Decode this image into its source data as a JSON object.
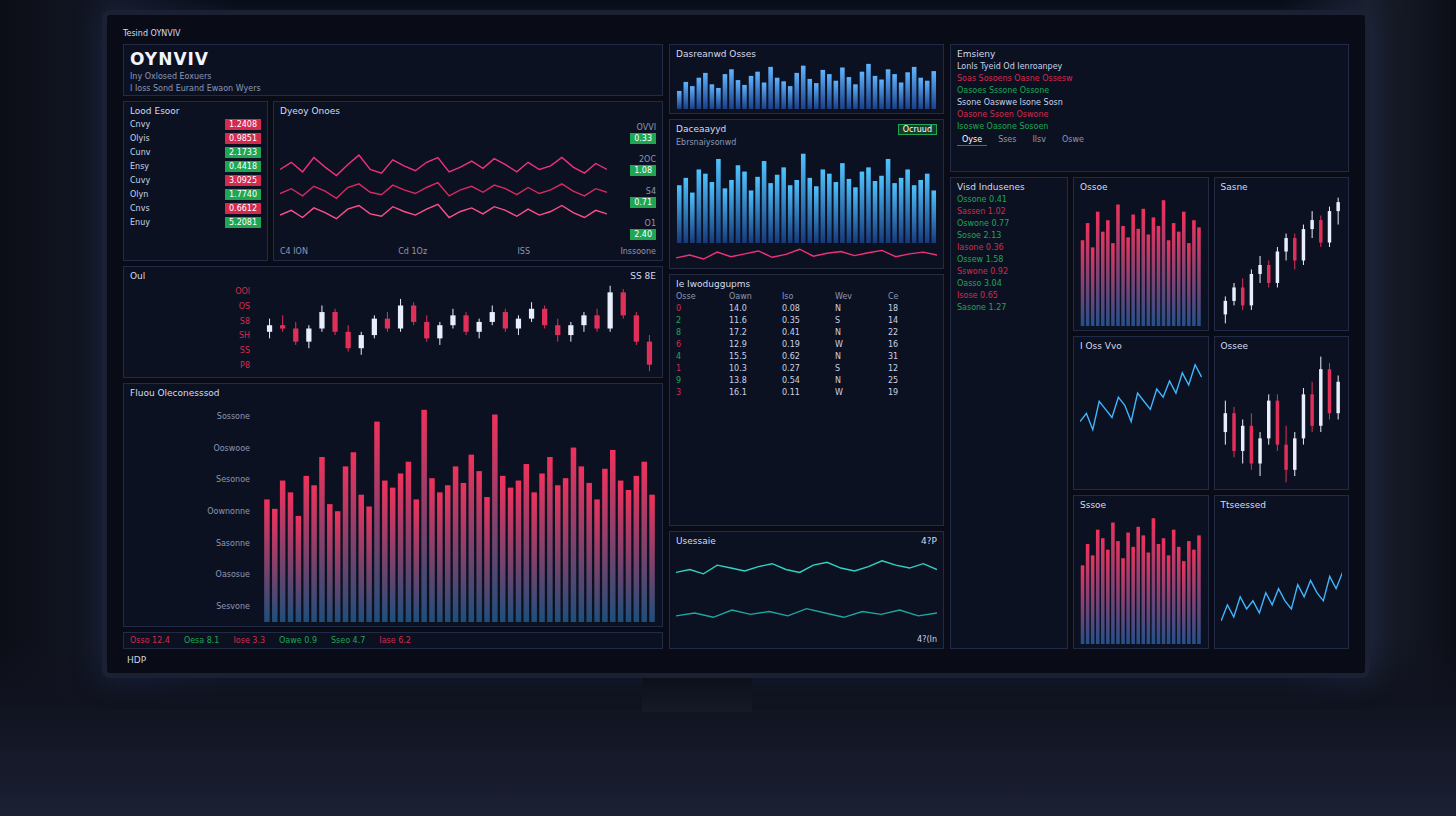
{
  "screen": {
    "title": "Tesind OYNVIV",
    "status": "HDP"
  },
  "header": {
    "logo": "OYNVIV",
    "subtitle": "Iny Oxlosed Eoxuers",
    "caption": "I Ioss Sond Eurand Ewaon Wyers"
  },
  "watchlist": {
    "title": "Lood Esoor",
    "rows": [
      {
        "name": "Cnvy",
        "value": "1.2408",
        "color": "#d42a4e"
      },
      {
        "name": "Olyis",
        "value": "0.9851",
        "color": "#d42a4e"
      },
      {
        "name": "Cunv",
        "value": "2.1733",
        "color": "#1fa653"
      },
      {
        "name": "Ensy",
        "value": "0.4418",
        "color": "#1fa653"
      },
      {
        "name": "Cuvy",
        "value": "3.0925",
        "color": "#d42a4e"
      },
      {
        "name": "Olyn",
        "value": "1.7740",
        "color": "#1fa653"
      },
      {
        "name": "Cnvs",
        "value": "0.6612",
        "color": "#d42a4e"
      },
      {
        "name": "Enuy",
        "value": "5.2081",
        "color": "#1fa653"
      }
    ]
  },
  "line_panel": {
    "title": "Dyeoy Onoes",
    "axis": [
      "C4 ION",
      "Cd 1Oz",
      "ISS",
      "Inssoone"
    ],
    "series": [
      [
        60,
        66,
        58,
        70,
        62,
        55,
        64,
        72,
        60,
        57,
        68,
        63,
        59,
        66,
        70,
        58,
        62,
        67,
        61,
        69,
        64,
        58,
        66,
        60,
        63,
        70,
        62,
        57,
        65,
        60
      ],
      [
        40,
        44,
        38,
        46,
        42,
        36,
        45,
        48,
        41,
        39,
        47,
        43,
        40,
        45,
        49,
        38,
        43,
        46,
        41,
        47,
        44,
        39,
        45,
        40,
        43,
        48,
        42,
        38,
        44,
        41
      ],
      [
        22,
        26,
        20,
        28,
        24,
        19,
        27,
        30,
        23,
        21,
        29,
        25,
        22,
        27,
        31,
        20,
        25,
        28,
        23,
        29,
        26,
        21,
        27,
        22,
        25,
        30,
        24,
        20,
        26,
        23
      ]
    ],
    "side": [
      {
        "label": "OVVI",
        "value": "0.33",
        "color": "#1fa653"
      },
      {
        "label": "2OC",
        "value": "1.08",
        "color": "#1fa653"
      },
      {
        "label": "S4",
        "value": "0.71",
        "color": "#1fa653"
      },
      {
        "label": "O1",
        "value": "2.40",
        "color": "#1fa653"
      }
    ]
  },
  "candles": {
    "title": "Oul",
    "reading": "SS 8E",
    "labels": [
      "OOl",
      "OS",
      "S8",
      "SH",
      "SS",
      "P8"
    ],
    "values": [
      [
        50,
        54,
        48,
        52
      ],
      [
        52,
        55,
        50,
        51
      ],
      [
        51,
        53,
        46,
        47
      ],
      [
        47,
        52,
        45,
        51
      ],
      [
        51,
        58,
        50,
        56
      ],
      [
        56,
        57,
        49,
        50
      ],
      [
        50,
        52,
        44,
        45
      ],
      [
        45,
        50,
        43,
        49
      ],
      [
        49,
        55,
        48,
        54
      ],
      [
        54,
        56,
        50,
        51
      ],
      [
        51,
        60,
        50,
        58
      ],
      [
        58,
        59,
        52,
        53
      ],
      [
        53,
        55,
        47,
        48
      ],
      [
        48,
        53,
        46,
        52
      ],
      [
        52,
        57,
        51,
        55
      ],
      [
        55,
        56,
        49,
        50
      ],
      [
        50,
        54,
        48,
        53
      ],
      [
        53,
        58,
        52,
        56
      ],
      [
        56,
        57,
        50,
        51
      ],
      [
        51,
        55,
        49,
        54
      ],
      [
        54,
        59,
        53,
        57
      ],
      [
        57,
        58,
        51,
        52
      ],
      [
        52,
        54,
        47,
        49
      ],
      [
        49,
        53,
        47,
        52
      ],
      [
        52,
        56,
        50,
        55
      ],
      [
        55,
        57,
        50,
        51
      ],
      [
        51,
        64,
        50,
        62
      ],
      [
        62,
        63,
        54,
        55
      ],
      [
        55,
        56,
        46,
        47
      ],
      [
        47,
        49,
        38,
        40
      ]
    ]
  },
  "volume": {
    "title": "Fluou Oleconesssod",
    "labels": [
      "Sossone",
      "Ooswooe",
      "Sesonoe",
      "Oownonne",
      "Sasonne",
      "Oasosue",
      "Sesvone"
    ],
    "values": [
      52,
      48,
      60,
      55,
      45,
      62,
      58,
      70,
      50,
      47,
      66,
      72,
      54,
      49,
      85,
      60,
      57,
      63,
      68,
      52,
      90,
      61,
      55,
      58,
      66,
      59,
      71,
      64,
      53,
      88,
      62,
      57,
      60,
      67,
      55,
      63,
      70,
      58,
      61,
      74,
      66,
      59,
      52,
      65,
      73,
      60,
      56,
      62,
      68,
      54
    ]
  },
  "tickers": [
    {
      "text": "Osso 12.4",
      "color": "#d42a4e"
    },
    {
      "text": "Oesa 8.1",
      "color": "#1fa653"
    },
    {
      "text": "Iose 3.3",
      "color": "#d42a4e"
    },
    {
      "text": "Oawe 0.9",
      "color": "#1fa653"
    },
    {
      "text": "Sseo 4.7",
      "color": "#1fa653"
    },
    {
      "text": "Iase 6.2",
      "color": "#d42a4e"
    }
  ],
  "spark": {
    "title": "Dasreanwd Osses",
    "values": [
      30,
      45,
      38,
      52,
      60,
      41,
      35,
      58,
      66,
      48,
      40,
      55,
      62,
      44,
      70,
      52,
      46,
      38,
      60,
      72,
      50,
      43,
      65,
      58,
      47,
      69,
      53,
      41,
      62,
      75,
      55,
      49,
      66,
      58,
      44,
      61,
      70,
      52,
      47,
      63
    ]
  },
  "blue_bars": {
    "title": "Daceaayyd",
    "subtitle": "Ebrsnaiysonwd",
    "badge": "Ocruud",
    "values": [
      55,
      62,
      48,
      70,
      66,
      58,
      80,
      52,
      60,
      74,
      68,
      50,
      63,
      78,
      57,
      65,
      72,
      55,
      60,
      85,
      62,
      54,
      70,
      66,
      58,
      76,
      61,
      53,
      68,
      72,
      59,
      64,
      80,
      57,
      62,
      70,
      55,
      60,
      66,
      50
    ],
    "line": [
      40,
      45,
      38,
      50,
      42,
      47,
      52,
      41,
      46,
      55,
      43,
      48,
      51,
      44,
      49,
      53,
      42,
      47,
      50,
      45
    ]
  },
  "orders": {
    "title": "Ie Iwoduggupms",
    "columns": [
      "Osse",
      "Oawn",
      "Iso",
      "Wev",
      "Ce"
    ],
    "rows": [
      {
        "cells": [
          "0",
          "14.0",
          "0.08",
          "N",
          "18"
        ],
        "color": "#d42a4e"
      },
      {
        "cells": [
          "2",
          "11.6",
          "0.35",
          "S",
          "14"
        ],
        "color": "#1fa653"
      },
      {
        "cells": [
          "8",
          "17.2",
          "0.41",
          "N",
          "22"
        ],
        "color": "#1fa653"
      },
      {
        "cells": [
          "6",
          "12.9",
          "0.19",
          "W",
          "16"
        ],
        "color": "#d42a4e"
      },
      {
        "cells": [
          "4",
          "15.5",
          "0.62",
          "N",
          "31"
        ],
        "color": "#1fa653"
      },
      {
        "cells": [
          "1",
          "10.3",
          "0.27",
          "S",
          "12"
        ],
        "color": "#d42a4e"
      },
      {
        "cells": [
          "9",
          "13.8",
          "0.54",
          "N",
          "25"
        ],
        "color": "#1fa653"
      },
      {
        "cells": [
          "3",
          "16.1",
          "0.11",
          "W",
          "19"
        ],
        "color": "#d42a4e"
      }
    ]
  },
  "mini": {
    "title": "Usessaie",
    "value": "4?P",
    "reading": "4?(In",
    "series": [
      [
        50,
        52,
        49,
        55,
        53,
        51,
        54,
        56,
        52,
        50,
        55,
        57,
        53,
        51,
        54,
        58,
        55,
        53,
        56,
        52
      ],
      [
        20,
        22,
        19,
        24,
        21,
        23,
        20,
        25,
        22,
        19,
        23,
        21,
        24,
        20,
        22
      ]
    ]
  },
  "news": {
    "title": "Emsieny",
    "subtitle": "Lonls Tyeid Od Ienroanpey",
    "lines": [
      {
        "text": "Soas Sosoens Oasne Ossesw",
        "color": "#d42a4e"
      },
      {
        "text": "Oasoes Sssone Ossone",
        "color": "#1fa653"
      },
      {
        "text": "Ssone Oaswwe Isone Sosn",
        "color": "#c9d2e8"
      },
      {
        "text": "Oasone Ssoen Oswone",
        "color": "#d42a4e"
      },
      {
        "text": "Isoswe Oasone Sosoen",
        "color": "#1fa653"
      }
    ],
    "tabs": [
      {
        "label": "Oyse",
        "selected": true
      },
      {
        "label": "Sses",
        "selected": false
      },
      {
        "label": "Ilsv",
        "selected": false
      },
      {
        "label": "Oswe",
        "selected": false
      }
    ]
  },
  "side_list": {
    "title": "Visd Indusenes",
    "rows": [
      {
        "text": "Ossone 0.41",
        "color": "#1fa653"
      },
      {
        "text": "Sassen 1.02",
        "color": "#d42a4e"
      },
      {
        "text": "Oswone 0.77",
        "color": "#1fa653"
      },
      {
        "text": "Sosoe 2.13",
        "color": "#1fa653"
      },
      {
        "text": "Iasone 0.36",
        "color": "#d42a4e"
      },
      {
        "text": "Ossew 1.58",
        "color": "#1fa653"
      },
      {
        "text": "Sswone 0.92",
        "color": "#d42a4e"
      },
      {
        "text": "Oasso 3.04",
        "color": "#1fa653"
      },
      {
        "text": "Isose 0.65",
        "color": "#d42a4e"
      },
      {
        "text": "Sasone 1.27",
        "color": "#1fa653"
      }
    ]
  },
  "right_charts": [
    {
      "title": "Ossoe",
      "kind": "bars",
      "values": [
        60,
        72,
        55,
        80,
        66,
        74,
        58,
        85,
        70,
        62,
        78,
        68,
        82,
        64,
        76,
        70,
        88,
        60,
        72,
        66,
        80,
        58,
        74,
        69
      ]
    },
    {
      "title": "Sasne",
      "kind": "candles",
      "values": [
        [
          40,
          44,
          38,
          43
        ],
        [
          43,
          47,
          42,
          46
        ],
        [
          46,
          48,
          41,
          42
        ],
        [
          42,
          50,
          41,
          49
        ],
        [
          49,
          53,
          47,
          51
        ],
        [
          51,
          52,
          46,
          47
        ],
        [
          47,
          55,
          46,
          54
        ],
        [
          54,
          58,
          52,
          57
        ],
        [
          57,
          58,
          50,
          52
        ],
        [
          52,
          60,
          51,
          59
        ],
        [
          59,
          63,
          57,
          61
        ],
        [
          61,
          62,
          55,
          56
        ],
        [
          56,
          64,
          55,
          63
        ],
        [
          63,
          66,
          60,
          65
        ]
      ]
    },
    {
      "title": "I Oss Vvo",
      "kind": "line",
      "values": [
        50,
        52,
        48,
        55,
        53,
        51,
        56,
        54,
        50,
        57,
        55,
        53,
        58,
        56,
        60,
        57,
        62,
        59,
        64,
        61
      ]
    },
    {
      "title": "Ossee",
      "kind": "candles",
      "values": [
        [
          50,
          55,
          48,
          53
        ],
        [
          53,
          54,
          46,
          47
        ],
        [
          47,
          52,
          45,
          51
        ],
        [
          51,
          53,
          44,
          45
        ],
        [
          45,
          50,
          43,
          49
        ],
        [
          49,
          56,
          48,
          55
        ],
        [
          55,
          56,
          47,
          48
        ],
        [
          48,
          51,
          42,
          44
        ],
        [
          44,
          50,
          43,
          49
        ],
        [
          49,
          57,
          48,
          56
        ],
        [
          56,
          58,
          50,
          51
        ],
        [
          51,
          62,
          50,
          60
        ],
        [
          60,
          61,
          52,
          53
        ],
        [
          53,
          59,
          52,
          58
        ]
      ]
    },
    {
      "title": "Sssoe",
      "kind": "bars",
      "values": [
        55,
        70,
        62,
        80,
        74,
        66,
        85,
        72,
        60,
        78,
        68,
        82,
        76,
        64,
        88,
        70,
        74,
        62,
        80,
        68,
        58,
        72,
        66,
        76
      ]
    },
    {
      "title": "Ttseessed",
      "kind": "line",
      "values": [
        40,
        44,
        41,
        46,
        43,
        45,
        42,
        47,
        44,
        48,
        45,
        43,
        49,
        46,
        50,
        47,
        45,
        51,
        48,
        52
      ]
    }
  ]
}
